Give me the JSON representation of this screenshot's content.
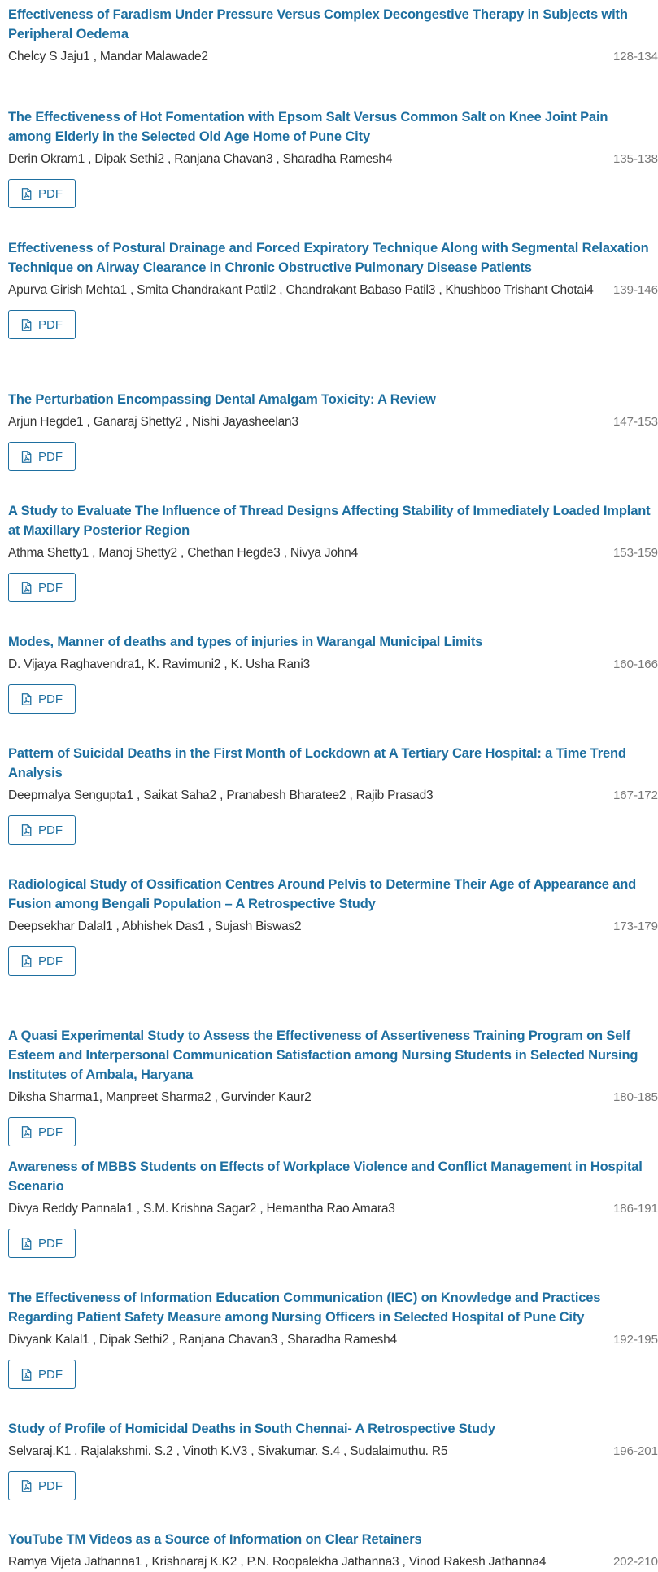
{
  "articles": [
    {
      "title": "Effectiveness of Faradism Under Pressure Versus Complex Decongestive Therapy in Subjects with Peripheral Oedema",
      "authors": "Chelcy S Jaju1 , Mandar Malawade2",
      "pages": "128-134",
      "has_pdf": false
    },
    {
      "title": "The Effectiveness of Hot Fomentation with Epsom Salt Versus Common Salt on Knee Joint Pain among Elderly in the Selected Old Age Home of Pune City",
      "authors": "Derin Okram1 , Dipak Sethi2 , Ranjana Chavan3 , Sharadha Ramesh4",
      "pages": "135-138",
      "has_pdf": true
    },
    {
      "title": "Effectiveness of Postural Drainage and Forced Expiratory Technique Along with Segmental Relaxation Technique on Airway Clearance in Chronic Obstructive Pulmonary Disease Patients",
      "authors": "Apurva Girish Mehta1 , Smita Chandrakant Patil2 , Chandrakant Babaso Patil3 , Khushboo Trishant Chotai4",
      "pages": "139-146",
      "has_pdf": true
    },
    {
      "title": "The Perturbation Encompassing Dental Amalgam Toxicity: A Review",
      "authors": "Arjun Hegde1 , Ganaraj Shetty2 , Nishi Jayasheelan3",
      "pages": "147-153",
      "has_pdf": true
    },
    {
      "title": "A Study to Evaluate The Influence of Thread Designs Affecting Stability of Immediately Loaded Implant at Maxillary Posterior Region",
      "authors": "Athma Shetty1 , Manoj Shetty2 , Chethan Hegde3 , Nivya John4",
      "pages": "153-159",
      "has_pdf": true
    },
    {
      "title": "Modes, Manner of deaths and types of injuries in Warangal Municipal Limits",
      "authors": "D. Vijaya Raghavendra1, K. Ravimuni2 , K. Usha Rani3",
      "pages": "160-166",
      "has_pdf": true
    },
    {
      "title": "Pattern of Suicidal Deaths in the First Month of Lockdown at A Tertiary Care Hospital: a Time Trend Analysis",
      "authors": "Deepmalya Sengupta1 , Saikat Saha2 , Pranabesh Bharatee2 , Rajib Prasad3",
      "pages": "167-172",
      "has_pdf": true
    },
    {
      "title": "Radiological Study of Ossification Centres Around Pelvis to Determine Their Age of Appearance and Fusion among Bengali Population – A Retrospective Study",
      "authors": "Deepsekhar Dalal1 , Abhishek Das1 , Sujash Biswas2",
      "pages": "173-179",
      "has_pdf": true
    },
    {
      "title": "A Quasi Experimental Study to Assess the Effectiveness of Assertiveness Training Program on Self Esteem and Interpersonal Communication Satisfaction among Nursing Students in Selected Nursing Institutes of Ambala, Haryana",
      "authors": "Diksha Sharma1, Manpreet Sharma2 , Gurvinder Kaur2",
      "pages": "180-185",
      "has_pdf": true
    },
    {
      "title": "Awareness of MBBS Students on Effects of Workplace Violence and Conflict Management in Hospital Scenario",
      "authors": "Divya Reddy Pannala1 , S.M. Krishna Sagar2 , Hemantha Rao Amara3",
      "pages": "186-191",
      "has_pdf": true
    },
    {
      "title": "The Effectiveness of Information Education Communication (IEC) on Knowledge and Practices Regarding Patient Safety Measure among Nursing Officers in Selected Hospital of Pune City",
      "authors": "Divyank Kalal1 , Dipak Sethi2 , Ranjana Chavan3 , Sharadha Ramesh4",
      "pages": "192-195",
      "has_pdf": true
    },
    {
      "title": "Study of Profile of Homicidal Deaths in South Chennai- A Retrospective Study",
      "authors": "Selvaraj.K1 , Rajalakshmi. S.2 , Vinoth K.V3 , Sivakumar. S.4 , Sudalaimuthu. R5",
      "pages": "196-201",
      "has_pdf": true
    },
    {
      "title": "YouTube TM Videos as a Source of Information on Clear Retainers",
      "authors": "Ramya Vijeta Jathanna1 , Krishnaraj K.K2 , P.N. Roopalekha Jathanna3 , Vinod Rakesh Jathanna4",
      "pages": "202-210",
      "has_pdf": false
    }
  ],
  "pdf_label": "PDF",
  "colors": {
    "link": "#1e6fa0",
    "text": "#333333",
    "pages": "#777777"
  },
  "icons": {
    "pdf": "file-pdf-icon"
  }
}
